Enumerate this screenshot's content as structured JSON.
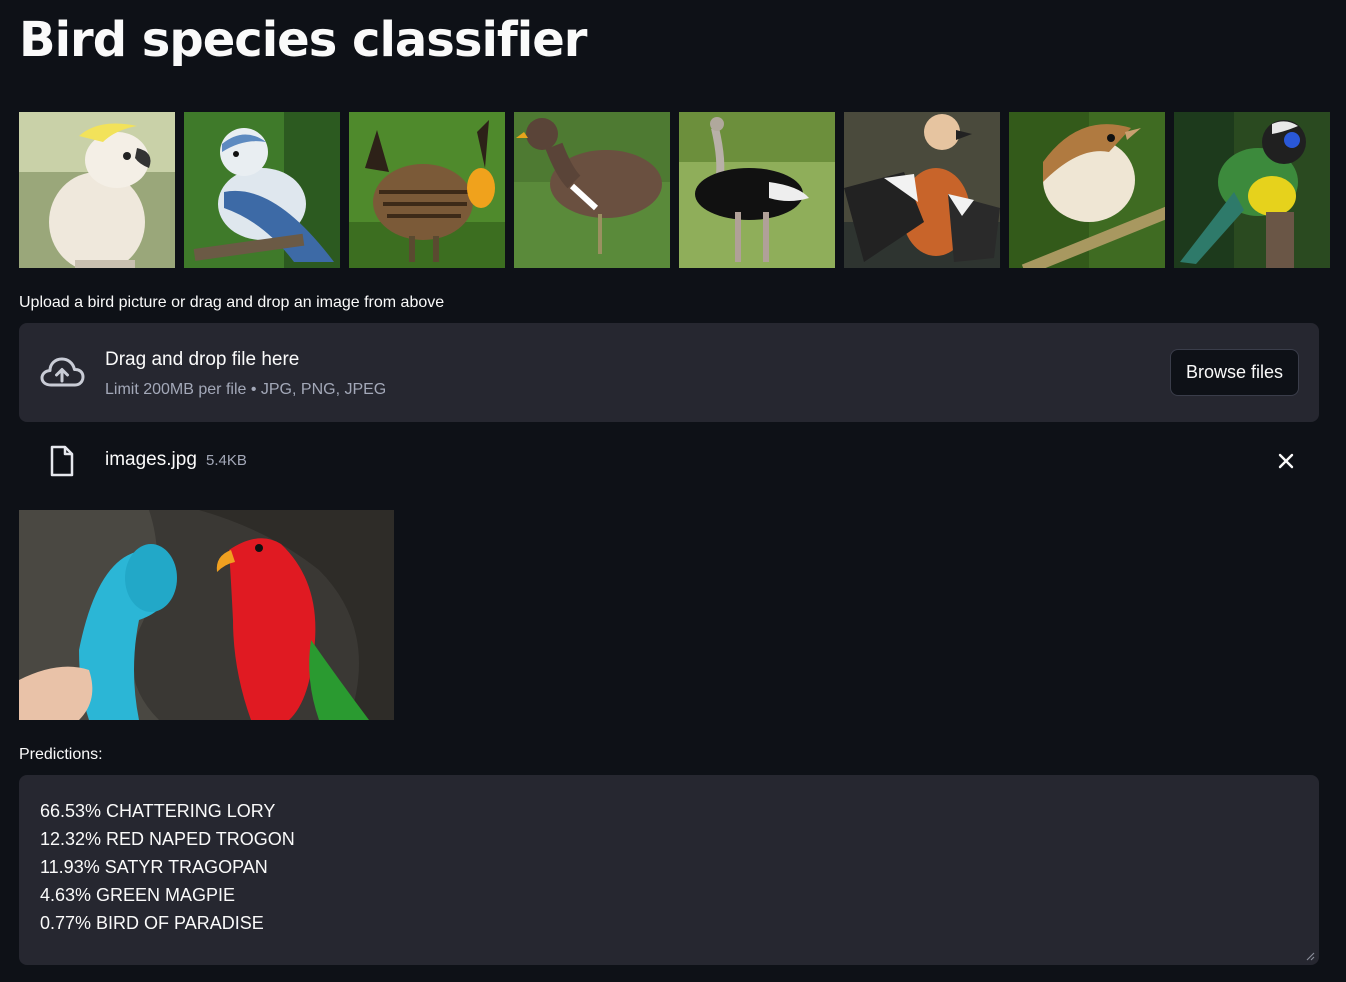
{
  "page": {
    "title": "Bird species classifier"
  },
  "gallery": {
    "images": [
      {
        "name": "cockatoo"
      },
      {
        "name": "blue tit"
      },
      {
        "name": "prairie chicken"
      },
      {
        "name": "moorhen"
      },
      {
        "name": "ostrich"
      },
      {
        "name": "ruddy shelduck"
      },
      {
        "name": "brown songbird"
      },
      {
        "name": "green jay"
      }
    ]
  },
  "uploader": {
    "label": "Upload a bird picture or drag and drop an image from above",
    "drop_title": "Drag and drop file here",
    "drop_subtitle": "Limit 200MB per file • JPG, PNG, JPEG",
    "browse_label": "Browse files",
    "icon": "cloud-upload-icon"
  },
  "uploaded_file": {
    "name": "images.jpg",
    "size": "5.4KB",
    "icon": "file-icon",
    "close_icon": "close-icon"
  },
  "predictions": {
    "label": "Predictions:",
    "lines": [
      "66.53% CHATTERING LORY",
      "12.32% RED NAPED TROGON",
      "11.93% SATYR TRAGOPAN",
      "4.63% GREEN MAGPIE",
      "0.77% BIRD OF PARADISE"
    ]
  },
  "colors": {
    "background": "#0e1117",
    "panel": "#262730",
    "text": "#fafafa",
    "muted_text": "#a3a8b8"
  }
}
